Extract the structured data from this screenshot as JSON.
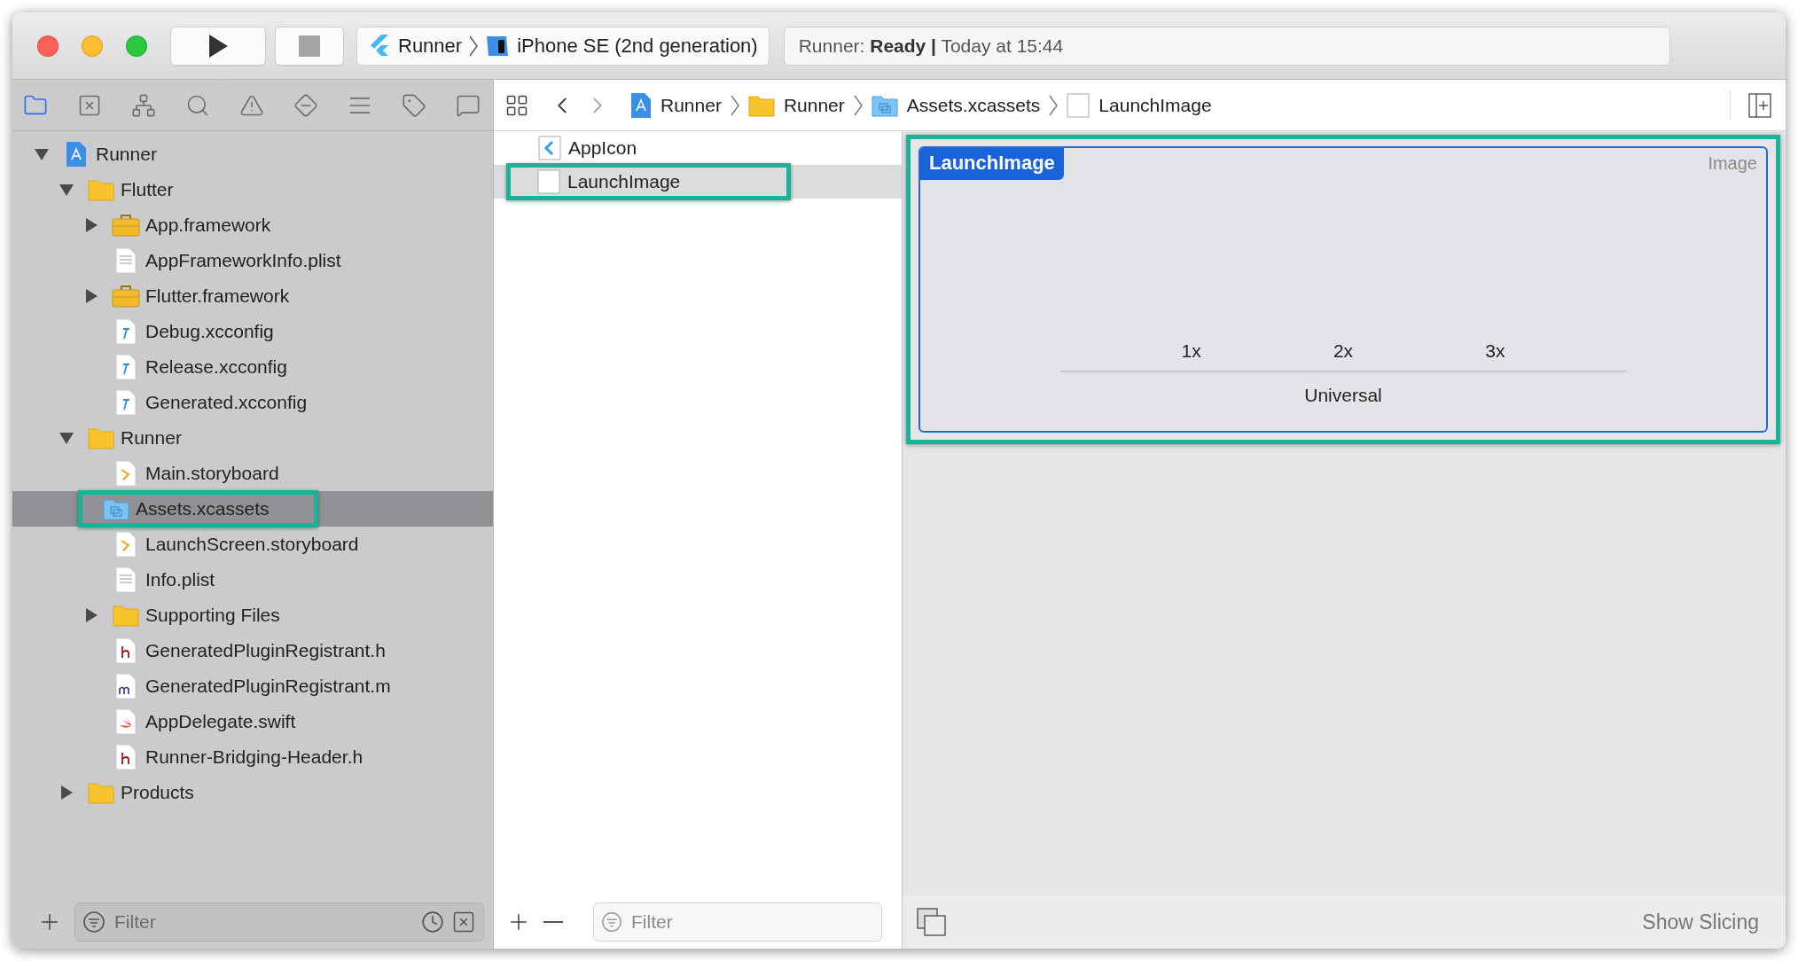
{
  "toolbar": {
    "scheme": {
      "target": "Runner",
      "device": "iPhone SE (2nd generation)"
    },
    "activity": "Runner: **Ready |** Today at 15:44"
  },
  "navigator": {
    "tabs": [
      {
        "kind": "folder",
        "selected": true
      },
      {
        "kind": "xbox",
        "selected": false
      },
      {
        "kind": "hierarchy",
        "selected": false
      },
      {
        "kind": "search",
        "selected": false
      },
      {
        "kind": "warning",
        "selected": false
      },
      {
        "kind": "diamond",
        "selected": false
      },
      {
        "kind": "lines",
        "selected": false
      },
      {
        "kind": "tag",
        "selected": false
      },
      {
        "kind": "bubble",
        "selected": false
      }
    ],
    "tree": [
      {
        "name": "Runner",
        "kind": "project",
        "expanded": true,
        "selected": false,
        "highlighted": false,
        "children": [
          {
            "name": "Flutter",
            "kind": "folder",
            "expanded": true,
            "selected": false,
            "highlighted": false,
            "children": [
              {
                "name": "App.framework",
                "kind": "framework",
                "expanded": false,
                "selected": false,
                "highlighted": false
              },
              {
                "name": "AppFrameworkInfo.plist",
                "kind": "plist",
                "selected": false,
                "highlighted": false
              },
              {
                "name": "Flutter.framework",
                "kind": "framework",
                "expanded": false,
                "selected": false,
                "highlighted": false
              },
              {
                "name": "Debug.xcconfig",
                "kind": "xcconfig",
                "selected": false,
                "highlighted": false
              },
              {
                "name": "Release.xcconfig",
                "kind": "xcconfig",
                "selected": false,
                "highlighted": false
              },
              {
                "name": "Generated.xcconfig",
                "kind": "xcconfig",
                "selected": false,
                "highlighted": false
              }
            ]
          },
          {
            "name": "Runner",
            "kind": "folder",
            "expanded": true,
            "selected": false,
            "highlighted": false,
            "children": [
              {
                "name": "Main.storyboard",
                "kind": "storyboard",
                "selected": false,
                "highlighted": false
              },
              {
                "name": "Assets.xcassets",
                "kind": "xcassets",
                "selected": true,
                "highlighted": true
              },
              {
                "name": "LaunchScreen.storyboard",
                "kind": "storyboard",
                "selected": false,
                "highlighted": false
              },
              {
                "name": "Info.plist",
                "kind": "plist",
                "selected": false,
                "highlighted": false
              },
              {
                "name": "Supporting Files",
                "kind": "folder",
                "expanded": false,
                "selected": false,
                "highlighted": false
              },
              {
                "name": "GeneratedPluginRegistrant.h",
                "kind": "header",
                "selected": false,
                "highlighted": false
              },
              {
                "name": "GeneratedPluginRegistrant.m",
                "kind": "objc",
                "selected": false,
                "highlighted": false
              },
              {
                "name": "AppDelegate.swift",
                "kind": "swift",
                "selected": false,
                "highlighted": false
              },
              {
                "name": "Runner-Bridging-Header.h",
                "kind": "header",
                "selected": false,
                "highlighted": false
              }
            ]
          },
          {
            "name": "Products",
            "kind": "folder",
            "expanded": false,
            "selected": false,
            "highlighted": false
          }
        ]
      }
    ],
    "filter": {
      "placeholder": "Filter"
    }
  },
  "breadcrumb": [
    {
      "label": "Runner",
      "kind": "project"
    },
    {
      "label": "Runner",
      "kind": "folder"
    },
    {
      "label": "Assets.xcassets",
      "kind": "xcassets"
    },
    {
      "label": "LaunchImage",
      "kind": "imageset"
    }
  ],
  "asset_list": {
    "items": [
      {
        "name": "AppIcon",
        "kind": "appicon",
        "selected": false,
        "highlighted": false
      },
      {
        "name": "LaunchImage",
        "kind": "imageset",
        "selected": true,
        "highlighted": true
      }
    ],
    "filter": {
      "placeholder": "Filter"
    }
  },
  "image_set": {
    "name": "LaunchImage",
    "type": "Image",
    "highlighted": true,
    "slots": [
      "1x",
      "2x",
      "3x"
    ],
    "idiom": "Universal"
  },
  "bottom_bar": {
    "button": "Show Slicing"
  }
}
